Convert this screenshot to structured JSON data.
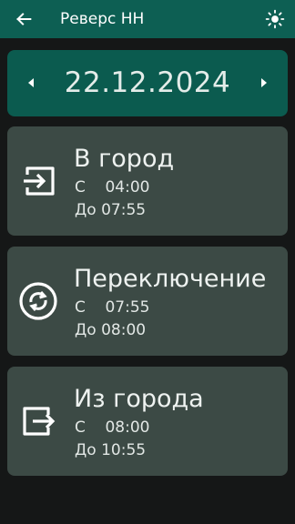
{
  "app_bar": {
    "title": "Реверс НН",
    "back_icon": "arrow-left-icon",
    "theme_icon": "sun-icon",
    "color": "#0d5f53"
  },
  "date_bar": {
    "date": "22.12.2024",
    "prev_icon": "triangle-left-icon",
    "next_icon": "triangle-right-icon",
    "color": "#0b5b4f"
  },
  "cards": [
    {
      "title": "В город",
      "from": "С    04:00",
      "to": "До 07:55",
      "icon": "login-arrow-icon"
    },
    {
      "title": "Переключение",
      "from": "С    07:55",
      "to": "До 08:00",
      "icon": "sync-circle-icon"
    },
    {
      "title": "Из города",
      "from": "С    08:00",
      "to": "До 10:55",
      "icon": "logout-arrow-icon"
    }
  ],
  "colors": {
    "background": "#151717",
    "card": "#3c4a45",
    "text": "#e8ecea"
  }
}
